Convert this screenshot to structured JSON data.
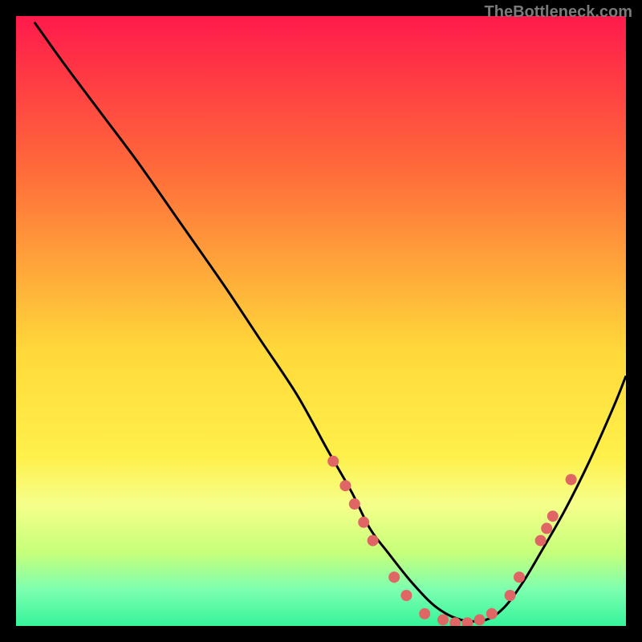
{
  "attribution": "TheBottleneck.com",
  "chart_data": {
    "type": "line",
    "title": "",
    "xlabel": "",
    "ylabel": "",
    "xlim": [
      0,
      100
    ],
    "ylim": [
      0,
      100
    ],
    "gradient_stops": [
      {
        "offset": 0,
        "color": "#ff1a4b"
      },
      {
        "offset": 25,
        "color": "#ff6a3a"
      },
      {
        "offset": 55,
        "color": "#ffd93a"
      },
      {
        "offset": 72,
        "color": "#fff04a"
      },
      {
        "offset": 80,
        "color": "#f6ff8a"
      },
      {
        "offset": 88,
        "color": "#c6ff7a"
      },
      {
        "offset": 94,
        "color": "#7dffb0"
      },
      {
        "offset": 100,
        "color": "#36f49a"
      }
    ],
    "series": [
      {
        "name": "bottleneck-curve",
        "x": [
          3,
          8,
          14,
          20,
          27,
          34,
          40,
          46,
          51,
          55,
          58,
          61,
          65,
          69,
          73,
          77,
          80,
          83,
          86,
          90,
          94,
          98,
          100
        ],
        "y": [
          99,
          92,
          84,
          76,
          66,
          56,
          47,
          38,
          29,
          22,
          16,
          12,
          7,
          3,
          1,
          1,
          3,
          7,
          12,
          19,
          27,
          36,
          41
        ]
      }
    ],
    "markers": {
      "name": "highlight-points",
      "color": "#e06666",
      "points": [
        {
          "x": 52,
          "y": 27
        },
        {
          "x": 54,
          "y": 23
        },
        {
          "x": 55.5,
          "y": 20
        },
        {
          "x": 57,
          "y": 17
        },
        {
          "x": 58.5,
          "y": 14
        },
        {
          "x": 62,
          "y": 8
        },
        {
          "x": 64,
          "y": 5
        },
        {
          "x": 67,
          "y": 2
        },
        {
          "x": 70,
          "y": 1
        },
        {
          "x": 72,
          "y": 0.5
        },
        {
          "x": 74,
          "y": 0.5
        },
        {
          "x": 76,
          "y": 1
        },
        {
          "x": 78,
          "y": 2
        },
        {
          "x": 81,
          "y": 5
        },
        {
          "x": 82.5,
          "y": 8
        },
        {
          "x": 86,
          "y": 14
        },
        {
          "x": 87,
          "y": 16
        },
        {
          "x": 88,
          "y": 18
        },
        {
          "x": 91,
          "y": 24
        }
      ]
    }
  }
}
